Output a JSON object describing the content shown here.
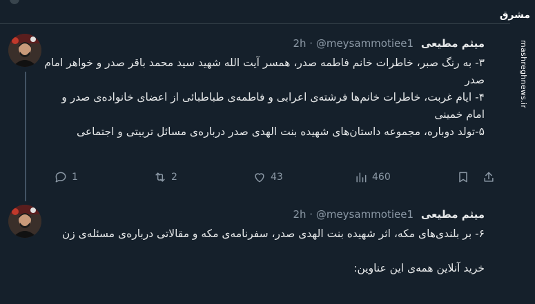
{
  "brand": {
    "logo_text": "مشرق",
    "url": "mashreghnews.ir"
  },
  "tweets": [
    {
      "name": "میثم مطیعی",
      "handle": "@meysammotiee1",
      "separator": "·",
      "time": "2h",
      "lines": [
        "۳- به رنگ صبر، خاطرات خانم فاطمه صدر، همسر آیت الله شهید سید محمد باقر صدر و خواهر امام صدر",
        "۴- ایام غربت، خاطرات خانم‌ها فرشته‌ی اعرابی و فاطمه‌ی طباطبائی از اعضای خانواده‌ی صدر و امام خمینی",
        "۵-تولد دوباره، مجموعه داستان‌های شهیده بنت الهدی صدر درباره‌ی مسائل تربیتی و اجتماعی"
      ],
      "actions": {
        "replies": "1",
        "retweets": "2",
        "likes": "43",
        "views": "460"
      }
    },
    {
      "name": "میثم مطیعی",
      "handle": "@meysammotiee1",
      "separator": "·",
      "time": "2h",
      "lines": [
        "۶- بر بلندی‌های مکه، اثر شهیده بنت الهدی صدر، سفرنامه‌ی مکه و مقالاتی درباره‌ی مسئله‌ی زن",
        "",
        "خرید آنلاین همه‌ی این عناوین:"
      ]
    }
  ],
  "icons": [
    "reply-icon",
    "retweet-icon",
    "like-icon",
    "views-icon",
    "bookmark-icon",
    "share-icon"
  ],
  "colors": {
    "background": "#15202b",
    "text": "#e7e9ea",
    "muted": "#8b98a5",
    "divider": "#38444d"
  }
}
